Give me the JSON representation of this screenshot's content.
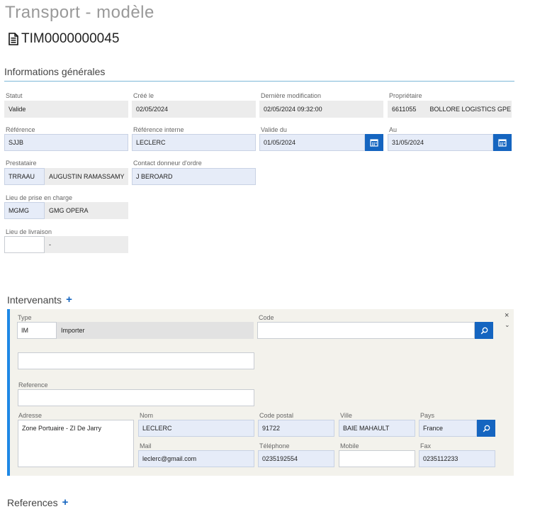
{
  "page": {
    "title": "Transport - modèle",
    "doc_id": "TIM0000000045"
  },
  "general": {
    "title": "Informations générales",
    "statut": {
      "label": "Statut",
      "value": "Valide"
    },
    "cree_le": {
      "label": "Créé le",
      "value": "02/05/2024"
    },
    "derniere_modif": {
      "label": "Dernière modification",
      "value": "02/05/2024 09:32:00"
    },
    "proprietaire": {
      "label": "Propriétaire",
      "code": "6611055",
      "name": "BOLLORE LOGISTICS GPE"
    },
    "reference": {
      "label": "Référence",
      "value": "SJJB"
    },
    "reference_interne": {
      "label": "Référence interne",
      "value": "LECLERC"
    },
    "valide_du": {
      "label": "Valide du",
      "value": "01/05/2024"
    },
    "au": {
      "label": "Au",
      "value": "31/05/2024"
    },
    "prestataire": {
      "label": "Prestataire",
      "code": "TRRAAU",
      "name": "AUGUSTIN RAMASSAMY"
    },
    "contact": {
      "label": "Contact donneur d'ordre",
      "value": "J BEROARD"
    },
    "lieu_prise": {
      "label": "Lieu de prise en charge",
      "code": "MGMG",
      "name": "GMG OPERA"
    },
    "lieu_livraison": {
      "label": "Lieu de livraison",
      "code": "",
      "name": "-"
    }
  },
  "intervenants": {
    "title": "Intervenants",
    "add_label": "+",
    "close_label": "×",
    "collapse_label": "⌄",
    "type": {
      "label": "Type",
      "code": "IM",
      "name": "Importer"
    },
    "code": {
      "label": "Code",
      "value": ""
    },
    "blank_field": {
      "value": ""
    },
    "reference": {
      "label": "Reference",
      "value": ""
    },
    "adresse": {
      "label": "Adresse",
      "value": "Zone Portuaire - ZI De Jarry"
    },
    "nom": {
      "label": "Nom",
      "value": "LECLERC"
    },
    "code_postal": {
      "label": "Code postal",
      "value": "91722"
    },
    "ville": {
      "label": "Ville",
      "value": "BAIE MAHAULT"
    },
    "pays": {
      "label": "Pays",
      "value": "France"
    },
    "mail": {
      "label": "Mail",
      "value": "leclerc@gmail.com"
    },
    "telephone": {
      "label": "Téléphone",
      "value": "0235192554"
    },
    "mobile": {
      "label": "Mobile",
      "value": ""
    },
    "fax": {
      "label": "Fax",
      "value": "0235112233"
    }
  },
  "references": {
    "title": "References",
    "add_label": "+"
  },
  "colors": {
    "accent": "#1565c0",
    "rule": "#7db8d8",
    "panel_bar": "#1e88e5"
  }
}
